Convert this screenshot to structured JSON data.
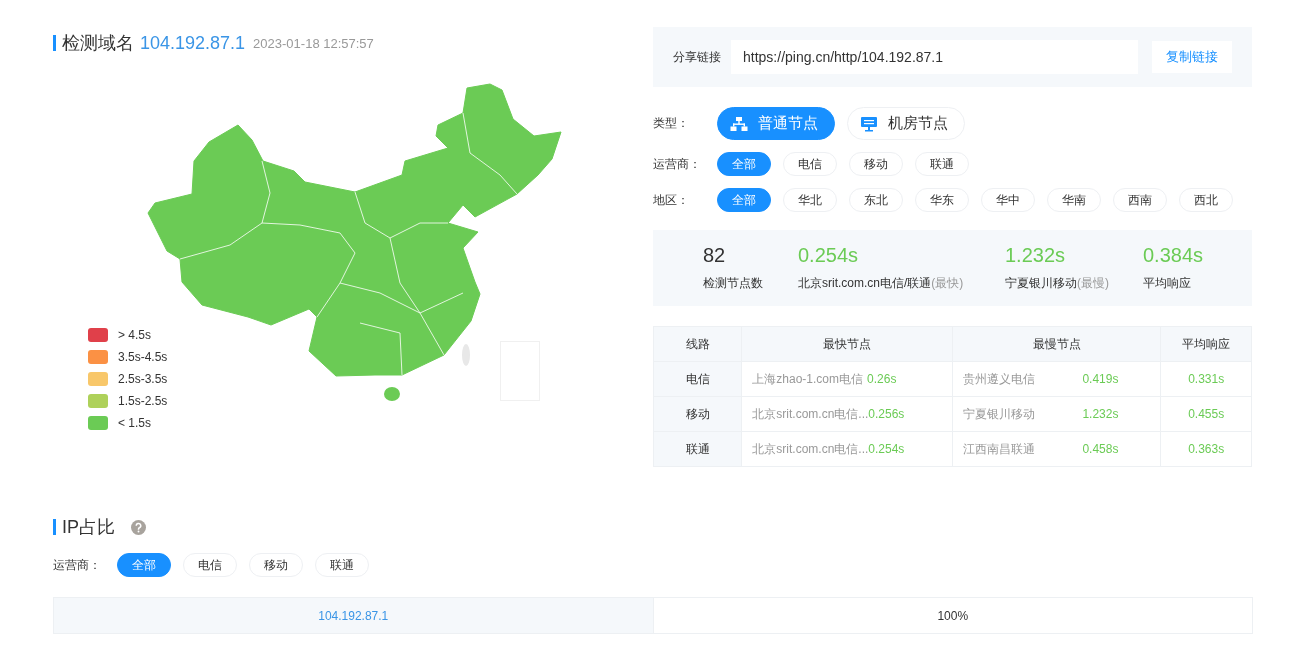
{
  "header": {
    "title": "检测域名",
    "domain": "104.192.87.1",
    "time": "2023-01-18 12:57:57"
  },
  "legend": [
    {
      "label": "> 4.5s",
      "color": "#e0404a"
    },
    {
      "label": "3.5s-4.5s",
      "color": "#fb9144"
    },
    {
      "label": "2.5s-3.5s",
      "color": "#f8c76a"
    },
    {
      "label": "1.5s-2.5s",
      "color": "#aed15a"
    },
    {
      "label": "< 1.5s",
      "color": "#6bcb55"
    }
  ],
  "share": {
    "label": "分享链接",
    "value": "https://ping.cn/http/104.192.87.1",
    "button": "复制链接"
  },
  "filters": [
    {
      "label": "类型：",
      "kind": "type",
      "options": [
        {
          "label": "普通节点",
          "selected": true
        },
        {
          "label": "机房节点",
          "selected": false
        }
      ]
    },
    {
      "label": "运营商：",
      "kind": "chip",
      "options": [
        {
          "label": "全部",
          "selected": true
        },
        {
          "label": "电信",
          "selected": false
        },
        {
          "label": "移动",
          "selected": false
        },
        {
          "label": "联通",
          "selected": false
        }
      ]
    },
    {
      "label": "地区：",
      "kind": "chip",
      "options": [
        {
          "label": "全部",
          "selected": true
        },
        {
          "label": "华北",
          "selected": false
        },
        {
          "label": "东北",
          "selected": false
        },
        {
          "label": "华东",
          "selected": false
        },
        {
          "label": "华中",
          "selected": false
        },
        {
          "label": "华南",
          "selected": false
        },
        {
          "label": "西南",
          "selected": false
        },
        {
          "label": "西北",
          "selected": false
        }
      ]
    }
  ],
  "stats": [
    {
      "kind": "count",
      "value": "82",
      "label": "检测节点数"
    },
    {
      "kind": "time",
      "value": "0.254s",
      "label": "北京srit.com.cn电信/联通",
      "note": "(最快)"
    },
    {
      "kind": "time",
      "value": "1.232s",
      "label": "宁夏银川移动",
      "note": "(最慢)"
    },
    {
      "kind": "time",
      "value": "0.384s",
      "label": "平均响应"
    }
  ],
  "route_table": {
    "columns": [
      "线路",
      "最快节点",
      "最慢节点",
      "平均响应"
    ],
    "rows": [
      {
        "line": "电信",
        "fastest_node": "上海zhao-1.com电信",
        "fastest_time": "0.26s",
        "slowest_node": "贵州遵义电信",
        "slowest_time": "0.419s",
        "average": "0.331s"
      },
      {
        "line": "移动",
        "fastest_node": "北京srit.com.cn电信...",
        "fastest_time": "0.256s",
        "slowest_node": "宁夏银川移动",
        "slowest_time": "1.232s",
        "average": "0.455s"
      },
      {
        "line": "联通",
        "fastest_node": "北京srit.com.cn电信...",
        "fastest_time": "0.254s",
        "slowest_node": "江西南昌联通",
        "slowest_time": "0.458s",
        "average": "0.363s"
      }
    ]
  },
  "ip_share": {
    "title": "IP占比",
    "filter": {
      "label": "运营商：",
      "options": [
        {
          "label": "全部",
          "selected": true
        },
        {
          "label": "电信",
          "selected": false
        },
        {
          "label": "移动",
          "selected": false
        },
        {
          "label": "联通",
          "selected": false
        }
      ]
    },
    "rows": [
      {
        "ip": "104.192.87.1",
        "share": "100%"
      }
    ]
  }
}
